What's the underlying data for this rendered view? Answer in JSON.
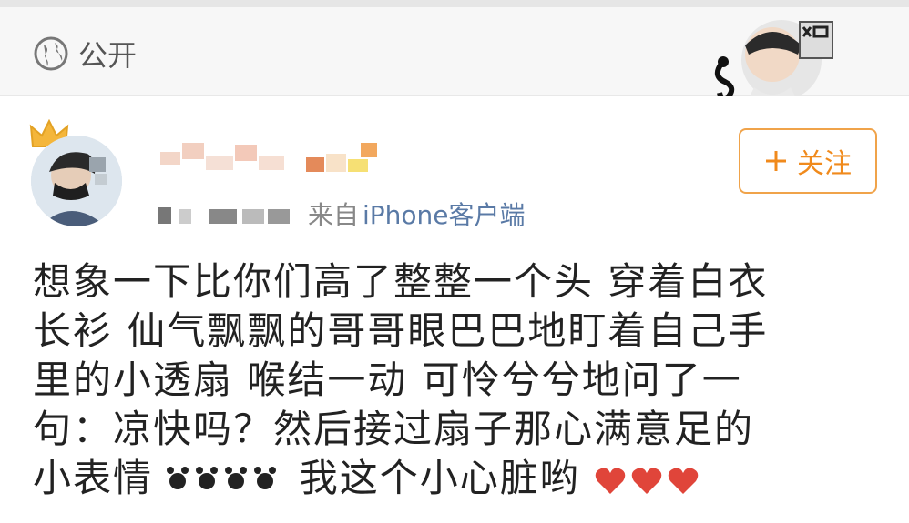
{
  "header": {
    "visibility_label": "公开",
    "visibility_icon": "globe-icon"
  },
  "post": {
    "source_prefix": "来自",
    "client": "iPhone客户端",
    "follow_label": "关注",
    "follow_icon": "plus-icon",
    "content_lines": [
      "想象一下比你们高了整整一个头 穿着白衣",
      "长衫 仙气飘飘的哥哥眼巴巴地盯着自己手",
      "里的小透扇 喉结一动 可怜兮兮地问了一",
      "句：凉快吗？然后接过扇子那心满意足的",
      "小表情",
      "我这个小心脏哟"
    ],
    "emoji_icons": [
      "heart-icon",
      "heart-icon",
      "heart-icon"
    ]
  },
  "colors": {
    "accent_orange": "#f08a1c",
    "link_blue": "#5a7aa6",
    "header_bg": "#f7f7f7"
  }
}
